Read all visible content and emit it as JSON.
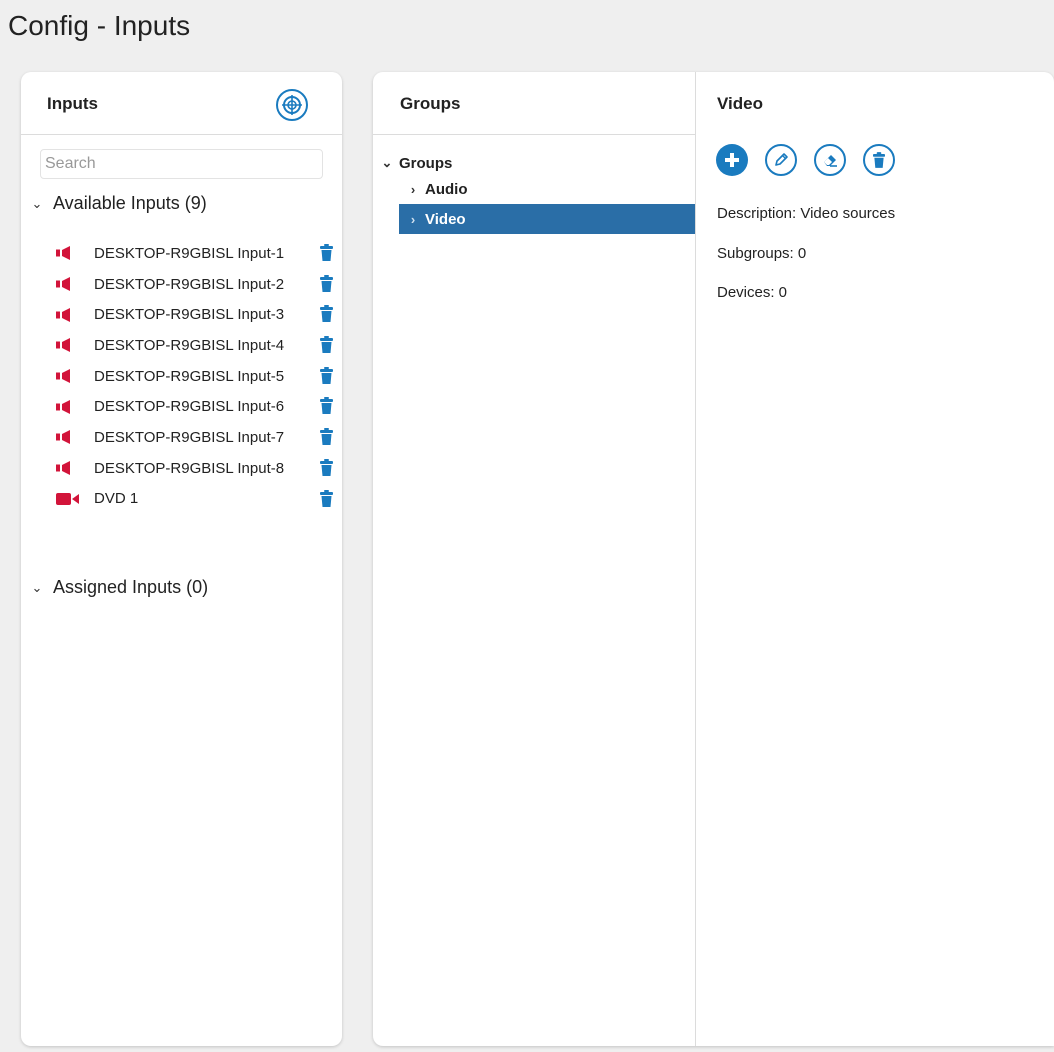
{
  "page": {
    "title": "Config - Inputs"
  },
  "inputs_panel": {
    "title": "Inputs",
    "search_placeholder": "Search",
    "search_value": "",
    "available_label": "Available Inputs (9)",
    "assigned_label": "Assigned Inputs (0)",
    "available_items": [
      {
        "label": "DESKTOP-R9GBISL Input-1",
        "icon": "speaker-icon"
      },
      {
        "label": "DESKTOP-R9GBISL Input-2",
        "icon": "speaker-icon"
      },
      {
        "label": "DESKTOP-R9GBISL Input-3",
        "icon": "speaker-icon"
      },
      {
        "label": "DESKTOP-R9GBISL Input-4",
        "icon": "speaker-icon"
      },
      {
        "label": "DESKTOP-R9GBISL Input-5",
        "icon": "speaker-icon"
      },
      {
        "label": "DESKTOP-R9GBISL Input-6",
        "icon": "speaker-icon"
      },
      {
        "label": "DESKTOP-R9GBISL Input-7",
        "icon": "speaker-icon"
      },
      {
        "label": "DESKTOP-R9GBISL Input-8",
        "icon": "speaker-icon"
      },
      {
        "label": "DVD 1",
        "icon": "video-camera-icon"
      }
    ]
  },
  "groups_panel": {
    "title": "Groups",
    "tree_root": "Groups",
    "tree_children": [
      {
        "label": "Audio",
        "selected": false
      },
      {
        "label": "Video",
        "selected": true
      }
    ]
  },
  "detail_panel": {
    "title": "Video",
    "description": "Description: Video sources",
    "subgroups": "Subgroups: 0",
    "devices": "Devices: 0"
  },
  "colors": {
    "accent": "#1a7bbf",
    "selected_row": "#2a6ea7",
    "input_icon": "#d2143a"
  }
}
